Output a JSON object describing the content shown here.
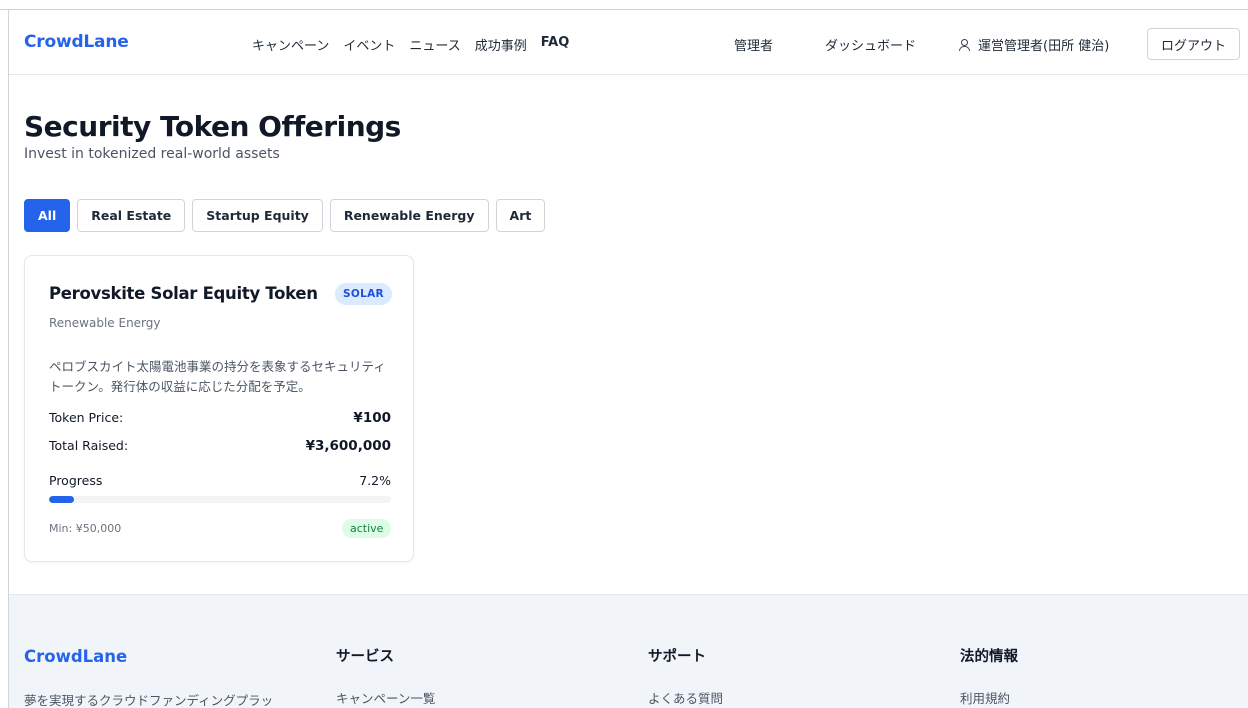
{
  "header": {
    "logo": "CrowdLane",
    "nav": [
      "キャンペーン",
      "イベント",
      "ニュース",
      "成功事例",
      "FAQ"
    ],
    "admin_label": "管理者",
    "dashboard_label": "ダッシュボード",
    "user_name": "運営管理者(田所 健治)",
    "logout_label": "ログアウト"
  },
  "hero": {
    "title": "Security Token Offerings",
    "subtitle": "Invest in tokenized real-world assets"
  },
  "filters": [
    "All",
    "Real Estate",
    "Startup Equity",
    "Renewable Energy",
    "Art"
  ],
  "filters_active": "All",
  "card": {
    "title": "Perovskite Solar Equity Token",
    "badge": "SOLAR",
    "category": "Renewable Energy",
    "description": "ペロブスカイト太陽電池事業の持分を表象するセキュリティトークン。発行体の収益に応じた分配を予定。",
    "token_price_label": "Token Price:",
    "token_price_value": "¥100",
    "total_raised_label": "Total Raised:",
    "total_raised_value": "¥3,600,000",
    "progress_label": "Progress",
    "progress_value": "7.2%",
    "progress_fraction": 0.072,
    "min_text": "Min: ¥50,000",
    "status": "active"
  },
  "footer": {
    "logo": "CrowdLane",
    "tagline": "夢を実現するクラウドファンディングプラッ",
    "services_heading": "サービス",
    "services_link": "キャンペーン一覧",
    "support_heading": "サポート",
    "support_link": "よくある質問",
    "legal_heading": "法的情報",
    "legal_link": "利用規約"
  },
  "colors": {
    "accent": "#2563eb",
    "badge_bg": "#dbeafe",
    "status_bg": "#dcfce7",
    "status_text": "#15803d",
    "footer_bg": "#f1f5f9"
  }
}
